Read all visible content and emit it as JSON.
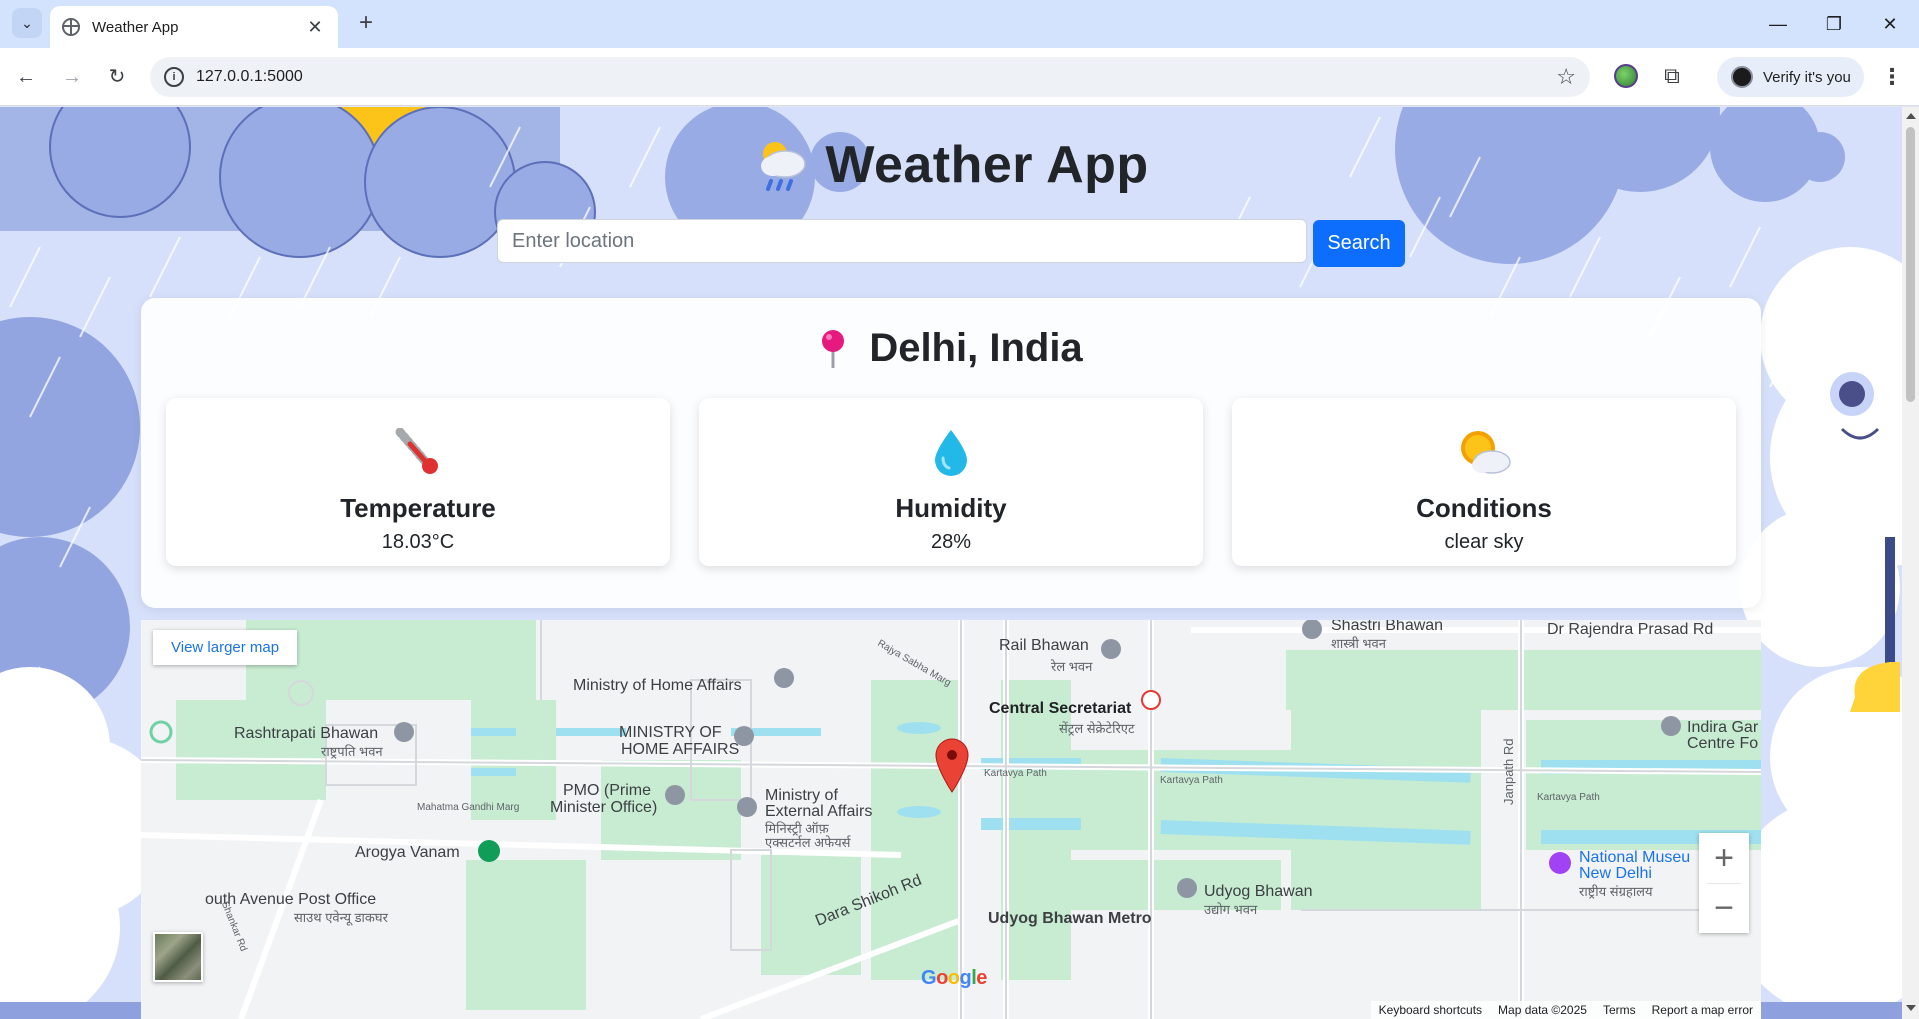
{
  "browser": {
    "tab_title": "Weather App",
    "url": "127.0.0.1:5000",
    "profile_label": "Verify it's you"
  },
  "app": {
    "title": "Weather App",
    "title_icon": "cloud-rain-sun-icon"
  },
  "search": {
    "placeholder": "Enter location",
    "value": "",
    "button_label": "Search"
  },
  "weather": {
    "location": "Delhi, India",
    "location_icon": "pushpin-icon",
    "cards": [
      {
        "icon": "thermometer-icon",
        "title": "Temperature",
        "value": "18.03°C"
      },
      {
        "icon": "droplet-icon",
        "title": "Humidity",
        "value": "28%"
      },
      {
        "icon": "sun-behind-cloud-icon",
        "title": "Conditions",
        "value": "clear sky"
      }
    ]
  },
  "map": {
    "view_larger_label": "View larger map",
    "labels": {
      "rail_bhawan": "Rail Bhawan",
      "rail_bhawan_hi": "रेल भवन",
      "shastri_bhawan": "Shastri Bhawan",
      "shastri_bhawan_hi": "शास्त्री भवन",
      "rajendra_prasad_rd": "Dr Rajendra Prasad Rd",
      "home_affairs": "Ministry of Home Affairs",
      "central_secretariat": "Central Secretariat",
      "central_secretariat_hi": "सेंट्रल सेक्रेटेरिएट",
      "rashtrapati_bhawan": "Rashtrapati Bhawan",
      "rashtrapati_bhawan_hi": "राष्ट्रपति भवन",
      "ministry_home_affairs_caps_1": "MINISTRY OF",
      "ministry_home_affairs_caps_2": "HOME AFFAIRS",
      "indira_gandhi_1": "Indira Gar",
      "indira_gandhi_2": "Centre Fo",
      "pmo_1": "PMO (Prime",
      "pmo_2": "Minister Office)",
      "mea_1": "Ministry of",
      "mea_2": "External Affairs",
      "mea_hi_1": "मिनिस्ट्री ऑफ़",
      "mea_hi_2": "एक्सटर्नल अफेयर्स",
      "kartavya_path": "Kartavya Path",
      "janpath_rd": "Janpath Rd",
      "mahatma_gandhi_marg": "Mahatma Gandhi Marg",
      "arogya_vanam": "Arogya Vanam",
      "national_museum_1": "National Museu",
      "national_museum_2": "New Delhi",
      "national_museum_hi": "राष्ट्रीय संग्रहालय",
      "south_avenue_1": "outh Avenue Post Office",
      "south_avenue_hi": "साउथ एवेन्यू डाकघर",
      "dara_shikoh_rd": "Dara Shikoh Rd",
      "udyog_bhawan": "Udyog Bhawan",
      "udyog_bhawan_hi": "उद्योग भवन",
      "udyog_bhawan_metro": "Udyog Bhawan Metro",
      "raja_sabha_marg": "Rajya Sabha Marg",
      "shankar_rd": "Shankar Rd"
    },
    "footer": {
      "shortcuts": "Keyboard shortcuts",
      "map_data": "Map data ©2025",
      "terms": "Terms",
      "report": "Report a map error"
    },
    "google_logo": "Google"
  }
}
